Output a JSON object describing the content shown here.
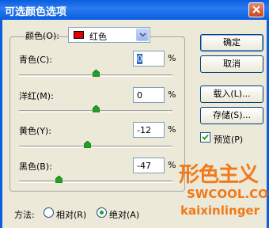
{
  "window": {
    "title": "可选颜色选项"
  },
  "colors_group": {
    "label": "颜色(O):",
    "selected_color": "红色",
    "swatch_color": "#e00000"
  },
  "sliders": [
    {
      "label": "青色(C):",
      "value": "0",
      "unit": "%",
      "position": 0.5
    },
    {
      "label": "洋红(M):",
      "value": "0",
      "unit": "%",
      "position": 0.5
    },
    {
      "label": "黄色(Y):",
      "value": "-12",
      "unit": "%",
      "position": 0.44
    },
    {
      "label": "黑色(B):",
      "value": "-47",
      "unit": "%",
      "position": 0.265
    }
  ],
  "buttons": {
    "ok": "确定",
    "cancel": "取消",
    "load": "载入(L)...",
    "save": "存储(S)..."
  },
  "preview": {
    "label": "预览(P)",
    "checked": true
  },
  "method": {
    "label": "方法:",
    "options": [
      {
        "label": "相对(R)",
        "selected": false
      },
      {
        "label": "绝对(A)",
        "selected": true
      }
    ]
  },
  "watermark": {
    "logo": "形色主义",
    "site": "SWCOOL.COM",
    "name": "kaixinlinger"
  },
  "theme": {
    "titlebar": "#0a5ee0",
    "dialog_bg": "#ece9d8",
    "watermark": "#f07a1a"
  }
}
